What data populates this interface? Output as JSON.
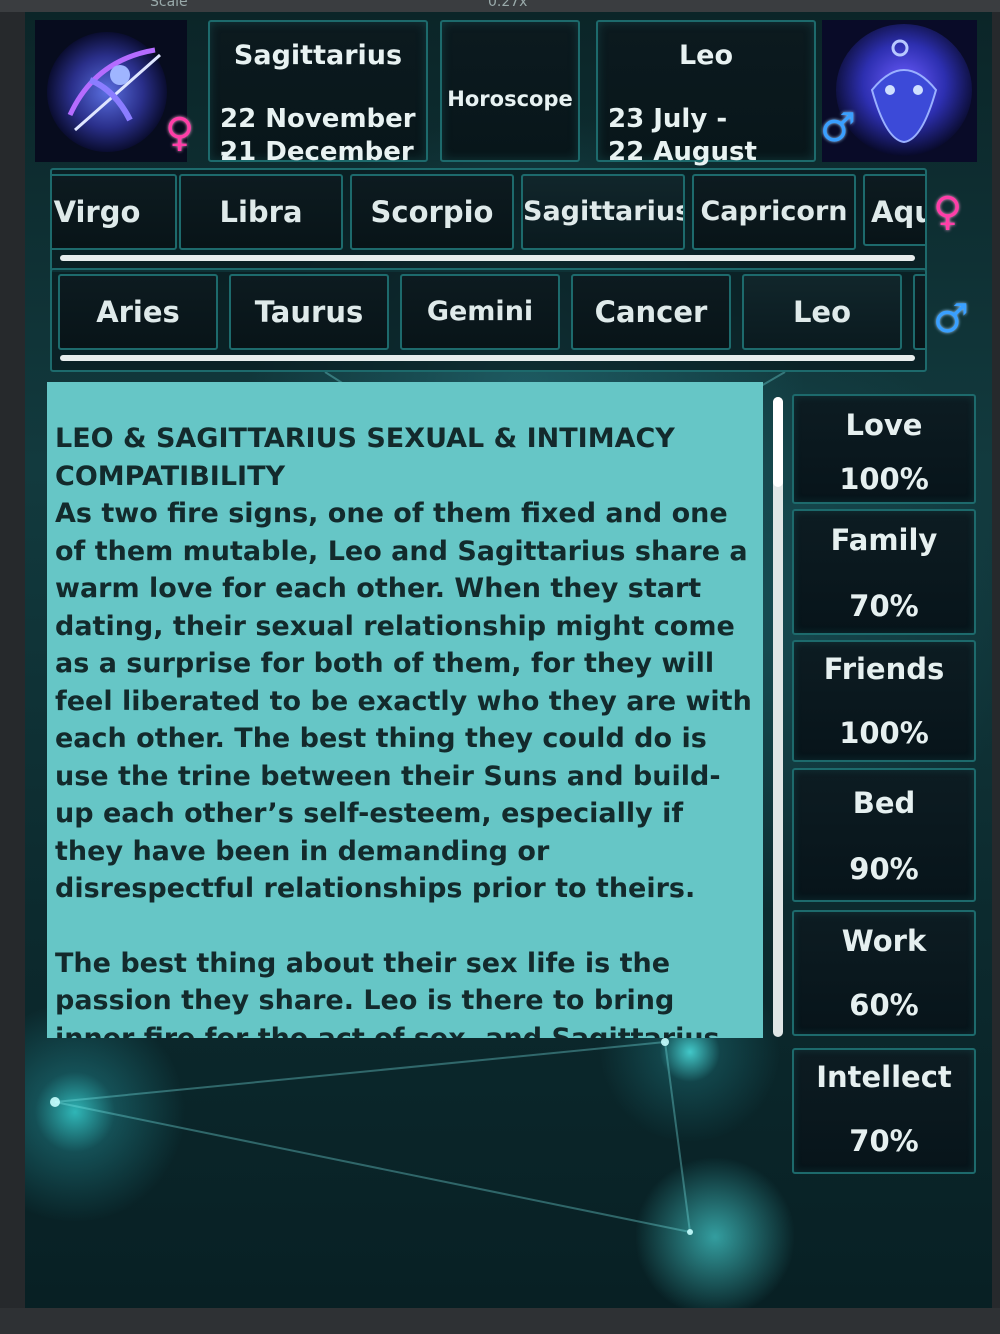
{
  "editor_bar": {
    "left_label": "",
    "scale_label": "Scale",
    "scale_value": "0.27x"
  },
  "left_sign": {
    "name": "Sagittarius",
    "date_start": "22 November -",
    "date_end": "21 December",
    "gender_symbol": "♀"
  },
  "center_label": "Horoscope",
  "right_sign": {
    "name": "Leo",
    "date_start": "23 July -",
    "date_end": "22 August",
    "gender_symbol": "♂"
  },
  "female_row": {
    "gender_symbol": "♀",
    "tabs": [
      "Virgo",
      "Libra",
      "Scorpio",
      "Sagittarius",
      "Capricorn",
      "Aquarius"
    ],
    "selected": "Sagittarius"
  },
  "male_row": {
    "gender_symbol": "♂",
    "tabs": [
      "Aries",
      "Taurus",
      "Gemini",
      "Cancer",
      "Leo"
    ],
    "selected": "Leo"
  },
  "article": {
    "heading": "LEO & SAGITTARIUS SEXUAL & INTIMACY COMPATIBILITY",
    "paragraph1": "As two fire signs, one of them fixed and one of them mutable, Leo and Sagittarius share a warm love for each other. When they start dating, their sexual relationship might come as a surprise for both of them, for they will feel liberated to be exactly who they are with each other. The best thing they could do is use the trine between their Suns and build-up each other’s self-esteem, especially if they have been in demanding or disrespectful relationships prior to theirs.",
    "paragraph2": "The best thing about their sex life is the passion they share. Leo is there to bring inner fire for the act of sex, and Sagittarius to"
  },
  "stats": [
    {
      "label": "Love",
      "value": "100%"
    },
    {
      "label": "Family",
      "value": "70%"
    },
    {
      "label": "Friends",
      "value": "100%"
    },
    {
      "label": "Bed",
      "value": "90%"
    },
    {
      "label": "Work",
      "value": "60%"
    },
    {
      "label": "Intellect",
      "value": "70%"
    }
  ],
  "colors": {
    "accent_border": "#1d6a6c",
    "text_panel": "#66c6c6",
    "female_symbol": "#ff3ea8",
    "male_symbol": "#3aa0ff"
  }
}
